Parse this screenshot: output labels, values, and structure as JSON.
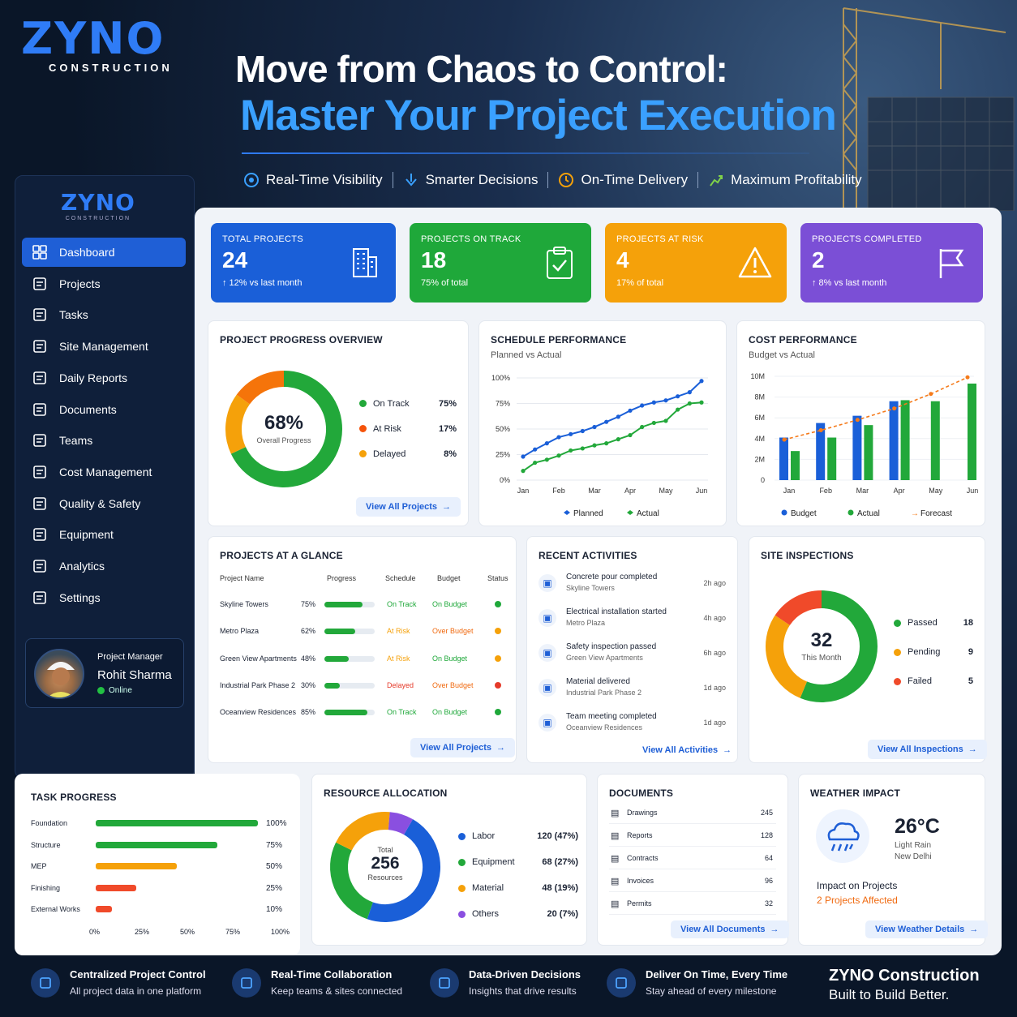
{
  "brand": {
    "name": "ZYNO",
    "sub": "CONSTRUCTION"
  },
  "hero": {
    "line1": "Move from Chaos to Control:",
    "line2": "Master Your Project Execution"
  },
  "features": [
    {
      "label": "Real-Time Visibility",
      "icon": "eye-icon"
    },
    {
      "label": "Smarter Decisions",
      "icon": "decision-icon"
    },
    {
      "label": "On-Time Delivery",
      "icon": "clock-icon"
    },
    {
      "label": "Maximum Profitability",
      "icon": "growth-icon"
    }
  ],
  "sidebar": {
    "items": [
      {
        "label": "Dashboard",
        "icon": "grid-icon"
      },
      {
        "label": "Projects",
        "icon": "projects-icon"
      },
      {
        "label": "Tasks",
        "icon": "tasks-icon"
      },
      {
        "label": "Site Management",
        "icon": "site-icon"
      },
      {
        "label": "Daily Reports",
        "icon": "report-icon"
      },
      {
        "label": "Documents",
        "icon": "document-icon"
      },
      {
        "label": "Teams",
        "icon": "teams-icon"
      },
      {
        "label": "Cost Management",
        "icon": "cost-icon"
      },
      {
        "label": "Quality & Safety",
        "icon": "shield-icon"
      },
      {
        "label": "Equipment",
        "icon": "equipment-icon"
      },
      {
        "label": "Analytics",
        "icon": "analytics-icon"
      },
      {
        "label": "Settings",
        "icon": "settings-icon"
      }
    ],
    "profile": {
      "role": "Project Manager",
      "name": "Rohit Sharma",
      "status": "Online"
    }
  },
  "kpis": [
    {
      "title": "TOTAL PROJECTS",
      "value": "24",
      "sub": "↑ 12% vs last month",
      "color": "#1a5fd8",
      "icon": "building-icon"
    },
    {
      "title": "PROJECTS ON TRACK",
      "value": "18",
      "sub": "75% of total",
      "color": "#1fa83a",
      "icon": "clipboard-check-icon"
    },
    {
      "title": "PROJECTS AT RISK",
      "value": "4",
      "sub": "17% of total",
      "color": "#f5a10a",
      "icon": "warning-icon"
    },
    {
      "title": "PROJECTS COMPLETED",
      "value": "2",
      "sub": "↑ 8% vs last month",
      "color": "#7b4fd6",
      "icon": "flag-icon"
    }
  ],
  "progress": {
    "title": "PROJECT PROGRESS OVERVIEW",
    "center_value": "68%",
    "center_label": "Overall Progress",
    "legend": [
      {
        "label": "On Track",
        "value": "75%",
        "color": "#22a83a"
      },
      {
        "label": "At Risk",
        "value": "17%",
        "color": "#f5530a"
      },
      {
        "label": "Delayed",
        "value": "8%",
        "color": "#f5a10a"
      }
    ],
    "button": "View All Projects"
  },
  "schedule": {
    "title": "SCHEDULE PERFORMANCE",
    "subtitle": "Planned vs Actual"
  },
  "cost": {
    "title": "COST PERFORMANCE",
    "subtitle": "Budget vs Actual"
  },
  "chart_data": [
    {
      "type": "line",
      "title": "SCHEDULE PERFORMANCE",
      "x": [
        "Jan",
        "Feb",
        "Mar",
        "Apr",
        "May",
        "Jun"
      ],
      "yticks": [
        "100%",
        "75%",
        "50%",
        "25%",
        "0%"
      ],
      "ylim": [
        0,
        100
      ],
      "series": [
        {
          "name": "Planned",
          "color": "#1a5fd8",
          "values": [
            23,
            30,
            36,
            42,
            45,
            48,
            52,
            57,
            62,
            68,
            73,
            76,
            78,
            82,
            86,
            97
          ]
        },
        {
          "name": "Actual",
          "color": "#22a83a",
          "values": [
            9,
            17,
            20,
            24,
            29,
            31,
            34,
            36,
            40,
            44,
            52,
            56,
            58,
            69,
            75,
            76
          ]
        }
      ]
    },
    {
      "type": "bar",
      "title": "COST PERFORMANCE",
      "categories": [
        "Jan",
        "Feb",
        "Mar",
        "Apr",
        "May",
        "Jun"
      ],
      "yticks": [
        "10M",
        "8M",
        "6M",
        "4M",
        "2M",
        "0"
      ],
      "ylim": [
        0,
        10
      ],
      "series": [
        {
          "name": "Budget",
          "color": "#1a5fd8",
          "values": [
            4.1,
            5.5,
            6.2,
            7.6,
            null,
            null
          ]
        },
        {
          "name": "Actual",
          "color": "#22a83a",
          "values": [
            2.8,
            4.1,
            5.3,
            7.7,
            7.6,
            9.3
          ]
        },
        {
          "name": "Forecast",
          "color": "#f57a1a",
          "values": [
            3.9,
            4.8,
            5.8,
            6.9,
            8.3,
            9.9
          ]
        }
      ]
    }
  ],
  "glance": {
    "title": "PROJECTS AT A GLANCE",
    "headers": [
      "Project Name",
      "Progress",
      "Schedule",
      "Budget",
      "Status"
    ],
    "rows": [
      {
        "name": "Skyline Towers",
        "pct": "75%",
        "progress": 0.75,
        "schedule": "On Track",
        "schedule_color": "#1fa83a",
        "budget": "On Budget",
        "budget_color": "#1fa83a",
        "status_color": "#1fa83a"
      },
      {
        "name": "Metro Plaza",
        "pct": "62%",
        "progress": 0.62,
        "schedule": "At Risk",
        "schedule_color": "#f5a10a",
        "budget": "Over Budget",
        "budget_color": "#f06a10",
        "status_color": "#f5a10a"
      },
      {
        "name": "Green View Apartments",
        "pct": "48%",
        "progress": 0.48,
        "schedule": "At Risk",
        "schedule_color": "#f5a10a",
        "budget": "On Budget",
        "budget_color": "#1fa83a",
        "status_color": "#f5a10a"
      },
      {
        "name": "Industrial Park Phase 2",
        "pct": "30%",
        "progress": 0.3,
        "schedule": "Delayed",
        "schedule_color": "#e53a2a",
        "budget": "Over Budget",
        "budget_color": "#f06a10",
        "status_color": "#e53a2a"
      },
      {
        "name": "Oceanview Residences",
        "pct": "85%",
        "progress": 0.85,
        "schedule": "On Track",
        "schedule_color": "#1fa83a",
        "budget": "On Budget",
        "budget_color": "#1fa83a",
        "status_color": "#1fa83a"
      }
    ],
    "button": "View All Projects"
  },
  "activities": {
    "title": "RECENT ACTIVITIES",
    "items": [
      {
        "title": "Concrete pour completed",
        "sub": "Skyline Towers",
        "time": "2h ago",
        "icon": "building-icon"
      },
      {
        "title": "Electrical installation started",
        "sub": "Metro Plaza",
        "time": "4h ago",
        "icon": "lightning-icon"
      },
      {
        "title": "Safety inspection passed",
        "sub": "Green View Apartments",
        "time": "6h ago",
        "icon": "clipboard-check-icon"
      },
      {
        "title": "Material delivered",
        "sub": "Industrial Park Phase 2",
        "time": "1d ago",
        "icon": "delivery-icon"
      },
      {
        "title": "Team meeting completed",
        "sub": "Oceanview Residences",
        "time": "1d ago",
        "icon": "meeting-icon"
      }
    ],
    "button": "View All Activities"
  },
  "inspections": {
    "title": "SITE INSPECTIONS",
    "center_value": "32",
    "center_label": "This Month",
    "legend": [
      {
        "label": "Passed",
        "value": "18",
        "color": "#22a83a"
      },
      {
        "label": "Pending",
        "value": "9",
        "color": "#f5a10a"
      },
      {
        "label": "Failed",
        "value": "5",
        "color": "#f04a2a"
      }
    ],
    "button": "View All Inspections"
  },
  "tasks": {
    "title": "TASK PROGRESS",
    "items": [
      {
        "label": "Foundation",
        "pct": "100%",
        "value": 1.0,
        "color": "#22a83a"
      },
      {
        "label": "Structure",
        "pct": "75%",
        "value": 0.75,
        "color": "#22a83a"
      },
      {
        "label": "MEP",
        "pct": "50%",
        "value": 0.5,
        "color": "#f5a10a"
      },
      {
        "label": "Finishing",
        "pct": "25%",
        "value": 0.25,
        "color": "#f04a2a"
      },
      {
        "label": "External Works",
        "pct": "10%",
        "value": 0.1,
        "color": "#f04a2a"
      }
    ],
    "axis": [
      "0%",
      "25%",
      "50%",
      "75%",
      "100%"
    ]
  },
  "resources": {
    "title": "RESOURCE ALLOCATION",
    "center_top": "Total",
    "center_value": "256",
    "center_bottom": "Resources",
    "legend": [
      {
        "label": "Labor",
        "value": "120 (47%)",
        "color": "#1a5fd8",
        "share": 47
      },
      {
        "label": "Equipment",
        "value": "68 (27%)",
        "color": "#22a83a",
        "share": 27
      },
      {
        "label": "Material",
        "value": "48 (19%)",
        "color": "#f5a10a",
        "share": 19
      },
      {
        "label": "Others",
        "value": "20 (7%)",
        "color": "#8a4fe0",
        "share": 7
      }
    ]
  },
  "documents": {
    "title": "DOCUMENTS",
    "items": [
      {
        "label": "Drawings",
        "count": "245"
      },
      {
        "label": "Reports",
        "count": "128"
      },
      {
        "label": "Contracts",
        "count": "64"
      },
      {
        "label": "Invoices",
        "count": "96"
      },
      {
        "label": "Permits",
        "count": "32"
      }
    ],
    "button": "View All Documents"
  },
  "weather": {
    "title": "WEATHER IMPACT",
    "temp": "26°C",
    "cond": "Light Rain",
    "loc": "New Delhi",
    "impact_label": "Impact on Projects",
    "impact_value": "2 Projects Affected",
    "button": "View Weather Details",
    "icon": "rain-cloud-icon"
  },
  "footer": {
    "items": [
      {
        "title": "Centralized Project Control",
        "sub": "All project data in one platform",
        "icon": "building-icon"
      },
      {
        "title": "Real-Time Collaboration",
        "sub": "Keep teams & sites connected",
        "icon": "teams-icon"
      },
      {
        "title": "Data-Driven Decisions",
        "sub": "Insights that drive results",
        "icon": "analytics-icon"
      },
      {
        "title": "Deliver On Time, Every Time",
        "sub": "Stay ahead of every milestone",
        "icon": "target-icon"
      }
    ],
    "brand_line1": "ZYNO Construction",
    "brand_line2": "Built to Build Better."
  }
}
